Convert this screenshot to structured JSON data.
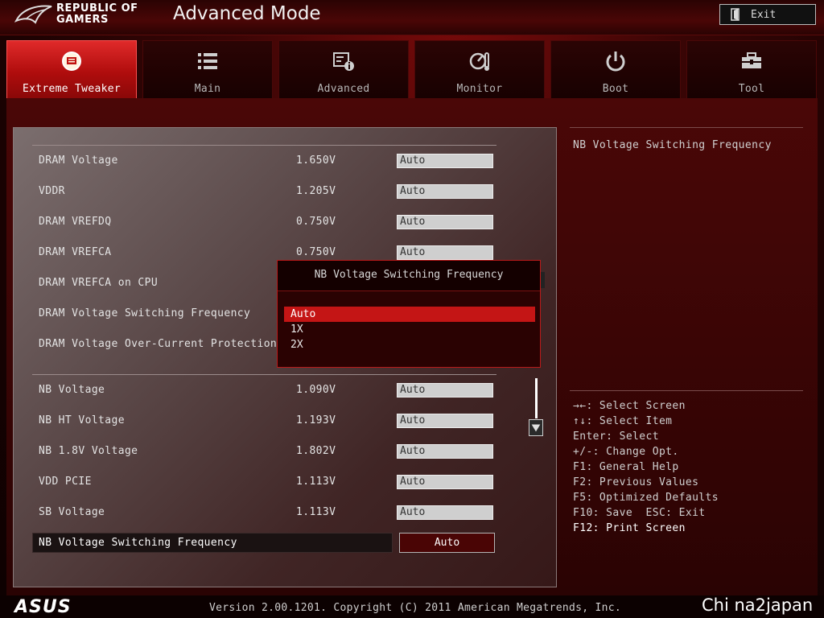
{
  "header": {
    "brand_line1": "REPUBLIC OF",
    "brand_line2": "GAMERS",
    "mode_title": "Advanced Mode",
    "exit_label": "Exit"
  },
  "tabs": [
    {
      "label": "Extreme Tweaker",
      "icon": "tweaker-icon",
      "active": true
    },
    {
      "label": "Main",
      "icon": "list-icon",
      "active": false
    },
    {
      "label": "Advanced",
      "icon": "advanced-icon",
      "active": false
    },
    {
      "label": "Monitor",
      "icon": "monitor-icon",
      "active": false
    },
    {
      "label": "Boot",
      "icon": "power-icon",
      "active": false
    },
    {
      "label": "Tool",
      "icon": "toolbox-icon",
      "active": false
    }
  ],
  "settings": [
    {
      "label": "DRAM Voltage",
      "value": "1.650V",
      "option": "Auto"
    },
    {
      "label": "VDDR",
      "value": "1.205V",
      "option": "Auto"
    },
    {
      "label": "DRAM VREFDQ",
      "value": "0.750V",
      "option": "Auto"
    },
    {
      "label": "DRAM VREFCA",
      "value": "0.750V",
      "option": "Auto"
    },
    {
      "label": "DRAM VREFCA on CPU",
      "value": "",
      "option": ""
    },
    {
      "label": "DRAM Voltage Switching Frequency",
      "value": "",
      "option": ""
    },
    {
      "label": "DRAM Voltage Over-Current Protection",
      "value": "",
      "option": ""
    },
    {
      "label": "NB Voltage",
      "value": "1.090V",
      "option": "Auto"
    },
    {
      "label": "NB HT Voltage",
      "value": "1.193V",
      "option": "Auto"
    },
    {
      "label": "NB 1.8V Voltage",
      "value": "1.802V",
      "option": "Auto"
    },
    {
      "label": "VDD PCIE",
      "value": "1.113V",
      "option": "Auto"
    },
    {
      "label": "SB Voltage",
      "value": "1.113V",
      "option": "Auto"
    }
  ],
  "selected_setting": {
    "label": "NB Voltage Switching Frequency",
    "option": "Auto"
  },
  "popup": {
    "title": "NB Voltage Switching Frequency",
    "options": [
      "Auto",
      "1X",
      "2X"
    ],
    "selected_index": 0
  },
  "help": {
    "description": "NB Voltage Switching Frequency",
    "keys": [
      "→←: Select Screen",
      "↑↓: Select Item",
      "Enter: Select",
      "+/-: Change Opt.",
      "F1: General Help",
      "F2: Previous Values",
      "F5: Optimized Defaults",
      "F10: Save  ESC: Exit",
      "F12: Print Screen"
    ]
  },
  "footer": {
    "asus_logo": "ASUS",
    "version": "Version 2.00.1201. Copyright (C) 2011 American Megatrends, Inc.",
    "watermark": "Chi na2japan"
  },
  "colors": {
    "accent": "#c41515",
    "panel": "#5c4a4a",
    "background": "#2a0303"
  }
}
